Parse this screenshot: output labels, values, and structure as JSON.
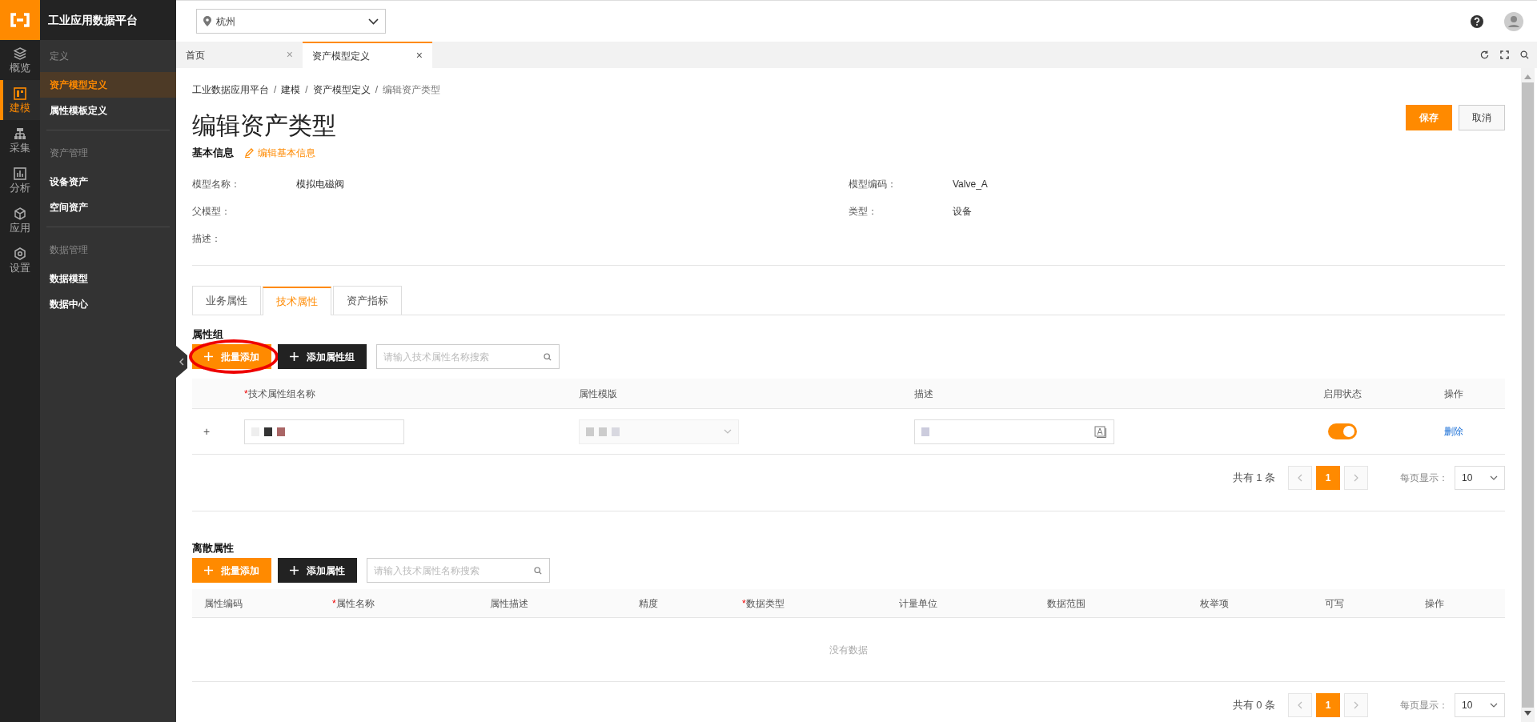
{
  "app": {
    "title": "工业应用数据平台"
  },
  "rail": [
    {
      "label": "概览",
      "selected": false
    },
    {
      "label": "建模",
      "selected": true
    },
    {
      "label": "采集",
      "selected": false
    },
    {
      "label": "分析",
      "selected": false
    },
    {
      "label": "应用",
      "selected": false
    },
    {
      "label": "设置",
      "selected": false
    }
  ],
  "nav": [
    {
      "label": "定义",
      "items": [
        {
          "label": "资产模型定义",
          "selected": true
        },
        {
          "label": "属性模板定义",
          "selected": false
        }
      ]
    },
    {
      "label": "资产管理",
      "items": [
        {
          "label": "设备资产",
          "selected": false
        },
        {
          "label": "空间资产",
          "selected": false
        }
      ]
    },
    {
      "label": "数据管理",
      "items": [
        {
          "label": "数据模型",
          "selected": false
        },
        {
          "label": "数据中心",
          "selected": false
        }
      ]
    }
  ],
  "location_select": {
    "value": "杭州"
  },
  "page_tabs": [
    {
      "label": "首页",
      "close": "×",
      "selected": false
    },
    {
      "label": "资产模型定义",
      "close": "×",
      "selected": true
    }
  ],
  "breadcrumb": [
    {
      "label": "工业数据应用平台"
    },
    {
      "separator": "/",
      "label": "建模"
    },
    {
      "separator": "/",
      "label": "资产模型定义"
    },
    {
      "separator": "/",
      "label": "编辑资产类型"
    }
  ],
  "title": "编辑资产类型",
  "actions": [
    {
      "kind": "primary",
      "label": "保存"
    },
    {
      "kind": "default",
      "label": "取消"
    }
  ],
  "basic_info": {
    "heading": "基本信息",
    "edit_link": "编辑基本信息",
    "fields": [
      {
        "label": "模型名称：",
        "value": "模拟电磁阀"
      },
      {
        "label": "模型编码：",
        "value": "Valve_A"
      },
      {
        "label": "父模型："
      },
      {
        "label": "类型：",
        "value": "设备"
      },
      {
        "label": "描述："
      }
    ]
  },
  "detail_tabs": [
    {
      "label": "业务属性",
      "selected": false
    },
    {
      "label": "技术属性",
      "selected": true
    },
    {
      "label": "资产指标",
      "selected": false
    }
  ],
  "attribute_groups": {
    "heading": "属性组",
    "buttons": [
      {
        "kind": "primary",
        "label": "批量添加",
        "highlighted": true
      },
      {
        "kind": "dark",
        "label": "添加属性组",
        "highlighted": false
      }
    ],
    "search": {
      "placeholder": "请输入技术属性名称搜索"
    },
    "columns": [
      {
        "label": "技术属性组名称",
        "required_mark": "*"
      },
      {
        "label": "属性模版"
      },
      {
        "label": "描述"
      },
      {
        "label": "启用状态"
      },
      {
        "label": "操作"
      }
    ],
    "rows": [
      {
        "expand": "+",
        "enabled": true,
        "action": "删除"
      }
    ],
    "pagination": {
      "total": "共有 1 条",
      "pages": [
        {
          "label": "1",
          "selected": true
        }
      ],
      "page_size_label": "每页显示：",
      "page_size": "10"
    }
  },
  "discrete_attributes": {
    "heading": "离散属性",
    "buttons": [
      {
        "kind": "primary",
        "label": "批量添加",
        "highlighted": false
      },
      {
        "kind": "dark",
        "label": "添加属性",
        "highlighted": false
      }
    ],
    "search": {
      "placeholder": "请输入技术属性名称搜索"
    },
    "columns": [
      {
        "label": "属性编码"
      },
      {
        "label": "属性名称",
        "required_mark": "*"
      },
      {
        "label": "属性描述"
      },
      {
        "label": "精度"
      },
      {
        "label": "数据类型",
        "required_mark": "*"
      },
      {
        "label": "计量单位"
      },
      {
        "label": "数据范围"
      },
      {
        "label": "枚举项"
      },
      {
        "label": "可写"
      },
      {
        "label": "操作"
      }
    ],
    "empty_text": "没有数据",
    "pagination": {
      "total": "共有 0 条",
      "pages": [
        {
          "label": "1",
          "selected": true
        }
      ],
      "page_size_label": "每页显示：",
      "page_size": "10"
    }
  }
}
